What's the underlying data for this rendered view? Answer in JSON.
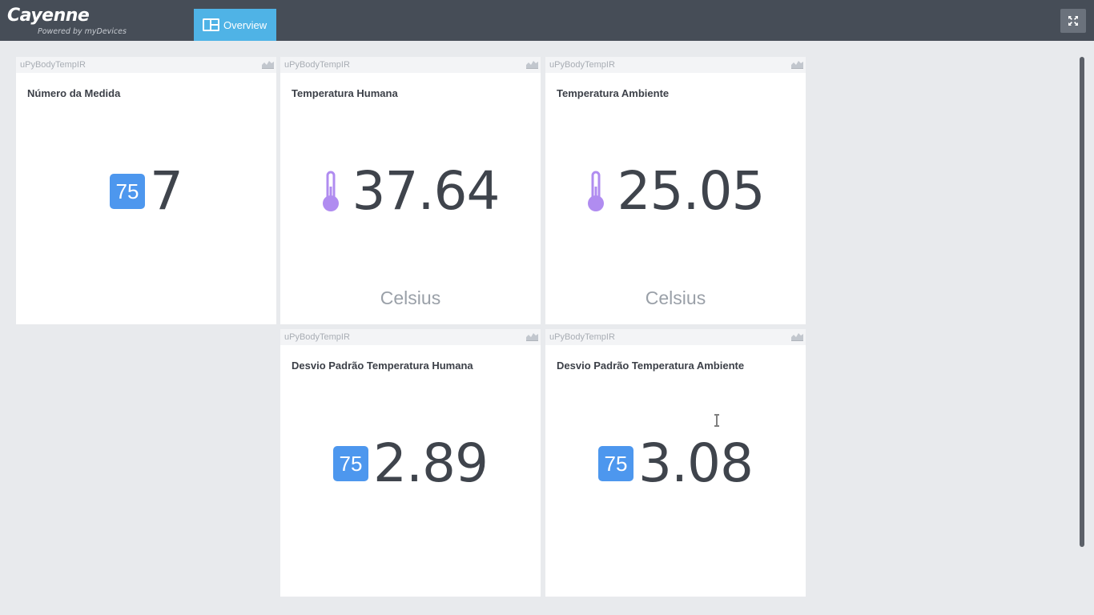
{
  "app": {
    "brand": "Cayenne",
    "powered_by": "Powered by myDevices",
    "tabs": [
      {
        "label": "Overview",
        "icon": "dashboard-grid-icon",
        "active": true
      }
    ],
    "fullscreen_icon": "fullscreen-icon"
  },
  "colors": {
    "topbar": "#464d57",
    "tab_active": "#4fb3e6",
    "badge": "#4d97ee",
    "thermometer": "#b08cf0",
    "background": "#e8eaed"
  },
  "widgets": [
    {
      "device": "uPyBodyTempIR",
      "title": "Número da Medida",
      "icon": "number-badge-icon",
      "badge_text": "75",
      "value": "7",
      "unit": ""
    },
    {
      "device": "uPyBodyTempIR",
      "title": "Temperatura Humana",
      "icon": "thermometer-icon",
      "badge_text": "",
      "value": "37.64",
      "unit": "Celsius"
    },
    {
      "device": "uPyBodyTempIR",
      "title": "Temperatura Ambiente",
      "icon": "thermometer-icon",
      "badge_text": "",
      "value": "25.05",
      "unit": "Celsius"
    },
    {
      "device": "uPyBodyTempIR",
      "title": "Desvio Padrão Temperatura Humana",
      "icon": "number-badge-icon",
      "badge_text": "75",
      "value": "2.89",
      "unit": ""
    },
    {
      "device": "uPyBodyTempIR",
      "title": "Desvio Padrão Temperatura Ambiente",
      "icon": "number-badge-icon",
      "badge_text": "75",
      "value": "3.08",
      "unit": ""
    }
  ]
}
